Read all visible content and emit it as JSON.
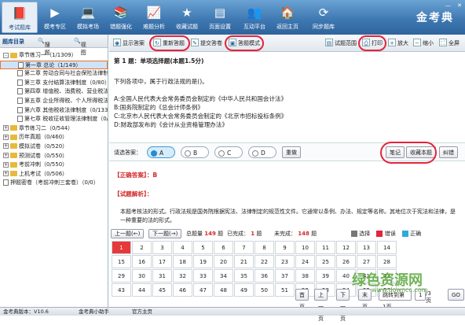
{
  "nav": [
    {
      "label": "考试题库",
      "icon": "📕"
    },
    {
      "label": "模考专区",
      "icon": "▶"
    },
    {
      "label": "模拟考场",
      "icon": "💻"
    },
    {
      "label": "错题强化",
      "icon": "📚"
    },
    {
      "label": "难题分析",
      "icon": "📈"
    },
    {
      "label": "收藏试题",
      "icon": "★"
    },
    {
      "label": "页面设置",
      "icon": "▤"
    },
    {
      "label": "互动平台",
      "icon": "👥"
    },
    {
      "label": "返回主页",
      "icon": "🏠"
    },
    {
      "label": "同步题库",
      "icon": "⟳"
    }
  ],
  "logo": "金考典",
  "window": {
    "min": "—",
    "close": "✕"
  },
  "left": {
    "tab_dir": "题库目录",
    "tab_search": "搜题",
    "tab_view": "视图",
    "tree": [
      {
        "text": "章节练习一（1/1309）",
        "lvl": 0,
        "type": "fd",
        "ex": "-"
      },
      {
        "text": "第一章  总论（1/149）",
        "lvl": 1,
        "type": "pg",
        "hl": true
      },
      {
        "text": "第二章  劳动合同与社会保险法律制度",
        "lvl": 1,
        "type": "pg"
      },
      {
        "text": "第三章  支付结算法律制度（0/80）",
        "lvl": 1,
        "type": "pg"
      },
      {
        "text": "第四章  增值税、消费税、营业税法律",
        "lvl": 1,
        "type": "pg"
      },
      {
        "text": "第五章  企业所得税、个人所得税法律",
        "lvl": 1,
        "type": "pg"
      },
      {
        "text": "第六章  其他税收法律制度（0/133）",
        "lvl": 1,
        "type": "pg"
      },
      {
        "text": "第七章  税收征收管理法律制度（0/",
        "lvl": 1,
        "type": "pg"
      },
      {
        "text": "章节练习二（0/544）",
        "lvl": 0,
        "type": "fd",
        "ex": "+"
      },
      {
        "text": "历年真题（0/460）",
        "lvl": 0,
        "type": "fd",
        "ex": "+"
      },
      {
        "text": "模拟试卷（0/520）",
        "lvl": 0,
        "type": "fd",
        "ex": "+"
      },
      {
        "text": "预测试卷（0/550）",
        "lvl": 0,
        "type": "fd",
        "ex": "+"
      },
      {
        "text": "考前冲刺（0/550）",
        "lvl": 0,
        "type": "fd",
        "ex": "+"
      },
      {
        "text": "上机考试（0/506）",
        "lvl": 0,
        "type": "fd",
        "ex": "+"
      },
      {
        "text": "押题密卷（考前冲刺三套卷）（0/0）",
        "lvl": 0,
        "type": "pg"
      }
    ]
  },
  "toolbar": {
    "show_answer": "显示答案",
    "reset_answer": "重新答题",
    "submit": "提交答卷",
    "print_mode": "答题模式",
    "paper_scope": "试题范围",
    "print": "打印",
    "zoom_in": "放大",
    "zoom_out": "缩小",
    "fullscreen": "全屏"
  },
  "question": {
    "header": "第 1 题：单项选择题(本题1.5分)",
    "stem": "下列各项中，属于行政法规的是()。",
    "options": [
      "A:全国人民代表大会常务委员会制定的《中华人民共和国会计法》",
      "B:国务院制定的《总会计师条例》",
      "C:北京市人民代表大会常务委员会制定的《北京市招标投标条例》",
      "D:财政部发布的《会计从业资格管理办法》"
    ],
    "choose_label": "请选答案：",
    "choices": [
      "A",
      "B",
      "C",
      "D"
    ],
    "selected": "A",
    "clear": "重做",
    "note": "笔记",
    "collect": "收藏本题",
    "error": "纠错",
    "answer_label": "【正确答案】：",
    "answer": "B",
    "analysis_label": "【试题解析】：",
    "analysis": "本题考核法的形式。行政法规是国务院根据宪法、法律制定的规范性文件。它通常以条例、办法、规定等名称。其地位次于宪法和法律，是一种重要的法的形式。"
  },
  "navbar": {
    "prev": "上一题(←)",
    "next": "下一题(→)",
    "total_label": "总题量",
    "total": "149",
    "unit": "题",
    "done_label": "已完成：",
    "done": "1",
    "todo_label": "未完成：",
    "todo": "148",
    "legend_done": "选择",
    "legend_wrong": "错误",
    "legend_right": "正确"
  },
  "grid_numbers": [
    "1",
    "2",
    "3",
    "4",
    "5",
    "6",
    "7",
    "8",
    "9",
    "10",
    "11",
    "12",
    "13",
    "14",
    "15",
    "16",
    "17",
    "18",
    "19",
    "20",
    "21",
    "22",
    "23",
    "24",
    "25",
    "26",
    "27",
    "28",
    "29",
    "30",
    "31",
    "32",
    "33",
    "34",
    "35",
    "36",
    "37",
    "38",
    "39",
    "40",
    "41",
    "42",
    "43",
    "44",
    "45",
    "46",
    "47",
    "48",
    "49",
    "50",
    "51",
    "52",
    "53",
    "54",
    "55",
    "56"
  ],
  "grid_current": "1",
  "paging": {
    "first": "首页",
    "prev": "上一页",
    "next": "下一页",
    "last": "末页",
    "jump": "跳转到第1页",
    "page": "1",
    "total": "/3页",
    "go": "GO"
  },
  "status": {
    "version": "金考典版本：V10.6",
    "assistant": "金考典小助手",
    "official": "官方主页"
  },
  "watermark": {
    "name": "绿色资源网",
    "url": "www.downcc.com"
  },
  "colors": {
    "accent": "#3d76b0",
    "highlight": "#e5233a",
    "correct": "#2eaadc"
  }
}
